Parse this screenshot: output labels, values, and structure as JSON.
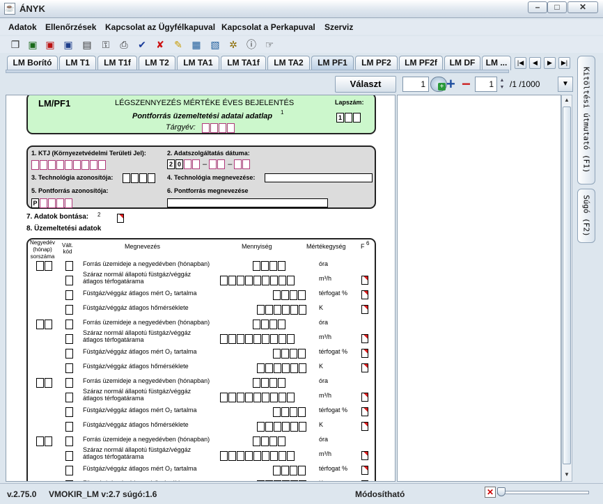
{
  "window": {
    "title": "ÁNYK",
    "icon": "java-icon",
    "controls": [
      "minimize",
      "maximize",
      "close"
    ]
  },
  "menu": [
    "Adatok",
    "Ellenőrzések",
    "Kapcsolat az Ügyfélkapuval",
    "Kapcsolat a Perkapuval",
    "Szerviz"
  ],
  "toolbar": [
    "copy-icon",
    "save-icon",
    "save-close-icon",
    "save-as-icon",
    "print-preview-icon",
    "key-icon",
    "print-icon",
    "check-icon",
    "cross-icon",
    "edit-icon",
    "calculator-icon",
    "calculator2-icon",
    "settings-icon",
    "info-icon",
    "hand-icon"
  ],
  "tabs": [
    "LM Borító",
    "LM T1",
    "LM T1f",
    "LM T2",
    "LM TA1",
    "LM TA1f",
    "LM TA2",
    "LM PF1",
    "LM PF2",
    "LM PF2f",
    "LM DF",
    "LM ..."
  ],
  "active_tab": "LM PF1",
  "selector": {
    "button": "Választ",
    "page": "1",
    "sheet": "1",
    "total": "/1 /1000"
  },
  "side_tabs": [
    "Kitöltési útmutató (F1)",
    "Súgó (F2)"
  ],
  "status": {
    "version": "v.2.75.0",
    "module": "VMOKIR_LM v:2.7 súgó:1.6",
    "mode": "Módosítható"
  },
  "form": {
    "code": "LM/PF1",
    "title": "LÉGSZENNYEZÉS MÉRTÉKE ÉVES BEJELENTÉS",
    "subtitle": "Pontforrás üzemeltetési adatai adatlap",
    "subtitle_sup": "1",
    "lapszam_label": "Lapszám:",
    "lapszam_value": "1",
    "targyev_label": "Tárgyév:",
    "f1": "1. KTJ (Környezetvédelmi Területi Jel):",
    "f2": "2. Adatszolgáltatás dátuma:",
    "f2_prefix": [
      "2",
      "0"
    ],
    "f3": "3. Technológia azonosítója:",
    "f4": "4. Technológia megnevezése:",
    "f5": "5. Pontforrás azonosítója:",
    "f5_prefix": "P",
    "f6": "6. Pontforrás megnevezése",
    "f7": "7. Adatok bontása:",
    "f7_sup": "2",
    "f8": "8. Üzemeltetési adatok",
    "col_quarter": "Negyedév (hónap) sorszáma",
    "col_change": "Vált. kód",
    "col_name": "Megnevezés",
    "col_qty": "Mennyiség",
    "col_unit": "Mértékegység",
    "col_f": "F",
    "col_f_sup": "6",
    "row_names": [
      "Forrás üzemideje a negyedévben (hónapban)",
      "Száraz normál állapotú füstgáz/véggáz átlagos térfogatárama",
      "Füstgáz/véggáz átlagos mért O₂ tartalma",
      "Füstgáz/véggáz átlagos hőmérséklete"
    ],
    "row_units": [
      "óra",
      "m³/h",
      "térfogat %",
      "K"
    ]
  }
}
